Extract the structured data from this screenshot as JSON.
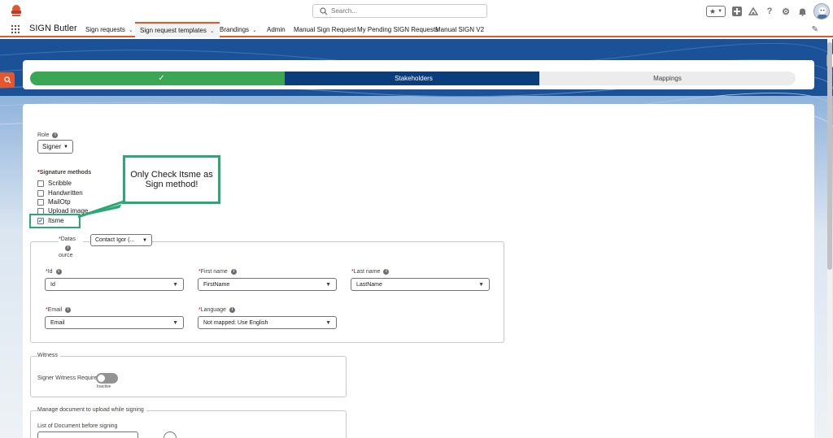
{
  "header": {
    "search_placeholder": "Search..."
  },
  "nav": {
    "app_name": "SIGN Butler",
    "items": [
      {
        "label": "Sign requests"
      },
      {
        "label": "Sign request templates"
      },
      {
        "label": "Brandings"
      },
      {
        "label": "Admin"
      },
      {
        "label": "Manual Sign Request"
      },
      {
        "label": "My Pending SIGN Requests"
      },
      {
        "label": "Manual SIGN V2"
      }
    ]
  },
  "progress": {
    "steps": [
      {
        "label": "",
        "state": "complete"
      },
      {
        "label": "Stakeholders",
        "state": "current"
      },
      {
        "label": "Mappings",
        "state": "upcoming"
      }
    ]
  },
  "role": {
    "label": "Role",
    "value": "Signer"
  },
  "signature_methods": {
    "label": "Signature methods",
    "options": [
      {
        "label": "Scribble",
        "checked": false
      },
      {
        "label": "Handwritten",
        "checked": false
      },
      {
        "label": "MailOtp",
        "checked": false
      },
      {
        "label": "Upload image",
        "checked": false
      },
      {
        "label": "Itsme",
        "checked": true
      }
    ]
  },
  "callout": {
    "text": "Only Check Itsme as Sign method!"
  },
  "datasource": {
    "label_line1": "Datas",
    "label_line2": "ource",
    "value": "Contact Igor (..."
  },
  "fields": {
    "id": {
      "label": "Id",
      "value": "Id"
    },
    "first_name": {
      "label": "First name",
      "value": "FirstName"
    },
    "last_name": {
      "label": "Last name",
      "value": "LastName"
    },
    "email": {
      "label": "Email",
      "value": "Email"
    },
    "language": {
      "label": "Language",
      "value": "Not mapped: Use English"
    }
  },
  "witness": {
    "title": "Witness",
    "toggle_label": "Signer Witness Required",
    "toggle_state": "Inactive"
  },
  "documents": {
    "title": "Manage document to upload while signing",
    "list_label": "List of Document before signing"
  },
  "colors": {
    "accent": "#e4572e",
    "step_complete": "#3ba755",
    "step_current": "#0b3d7a",
    "callout_border": "#2aa876",
    "background": "#1b5297"
  }
}
